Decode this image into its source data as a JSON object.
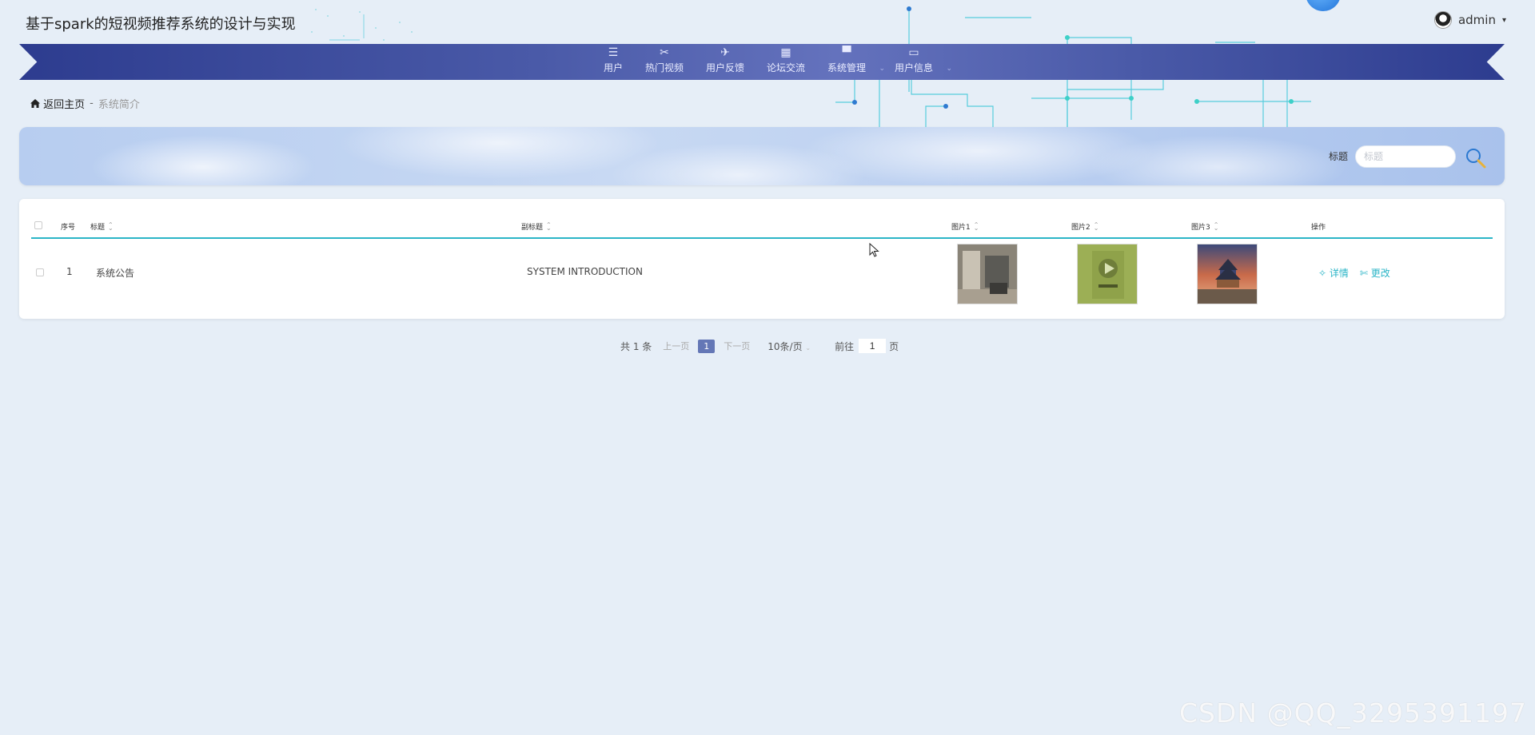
{
  "header": {
    "title": "基于spark的短视频推荐系统的设计与实现",
    "user_name": "admin",
    "user_caret": "▾"
  },
  "nav": {
    "items": [
      {
        "label": "用户",
        "icon": "list-icon",
        "glyph": "☰",
        "dropdown": false
      },
      {
        "label": "热门视频",
        "icon": "film-icon",
        "glyph": "✂",
        "dropdown": false
      },
      {
        "label": "用户反馈",
        "icon": "paper-plane-icon",
        "glyph": "✈",
        "dropdown": false
      },
      {
        "label": "论坛交流",
        "icon": "grid-icon",
        "glyph": "▦",
        "dropdown": false
      },
      {
        "label": "系统管理",
        "icon": "monitor-icon",
        "glyph": "▀",
        "dropdown": true
      },
      {
        "label": "用户信息",
        "icon": "card-icon",
        "glyph": "▭",
        "dropdown": true
      }
    ],
    "dropdown_glyph": "⌄"
  },
  "breadcrumb": {
    "home_icon": "home-icon",
    "home": "返回主页",
    "separator": "-",
    "current": "系统简介"
  },
  "search": {
    "label": "标题",
    "placeholder": "标题",
    "value": "",
    "button_icon": "magnifier-icon"
  },
  "table": {
    "headers": {
      "index": "序号",
      "title": "标题",
      "subtitle": "副标题",
      "image1": "图片1",
      "image2": "图片2",
      "image3": "图片3",
      "actions": "操作"
    },
    "rows": [
      {
        "index": "1",
        "title": "系统公告",
        "subtitle": "SYSTEM INTRODUCTION",
        "detail": "详情",
        "edit": "更改"
      }
    ]
  },
  "pagination": {
    "total": "共 1 条",
    "prev": "上一页",
    "current_page": "1",
    "next": "下一页",
    "page_size": "10条/页",
    "goto_label": "前往",
    "goto_value": "1",
    "page_suffix": "页"
  },
  "watermark": "CSDN @QQ_3295391197",
  "colors": {
    "nav_band": "#4a5aa8",
    "accent": "#2bb5c7",
    "page_bg": "#e6eef7",
    "active_page": "#6477b6"
  }
}
